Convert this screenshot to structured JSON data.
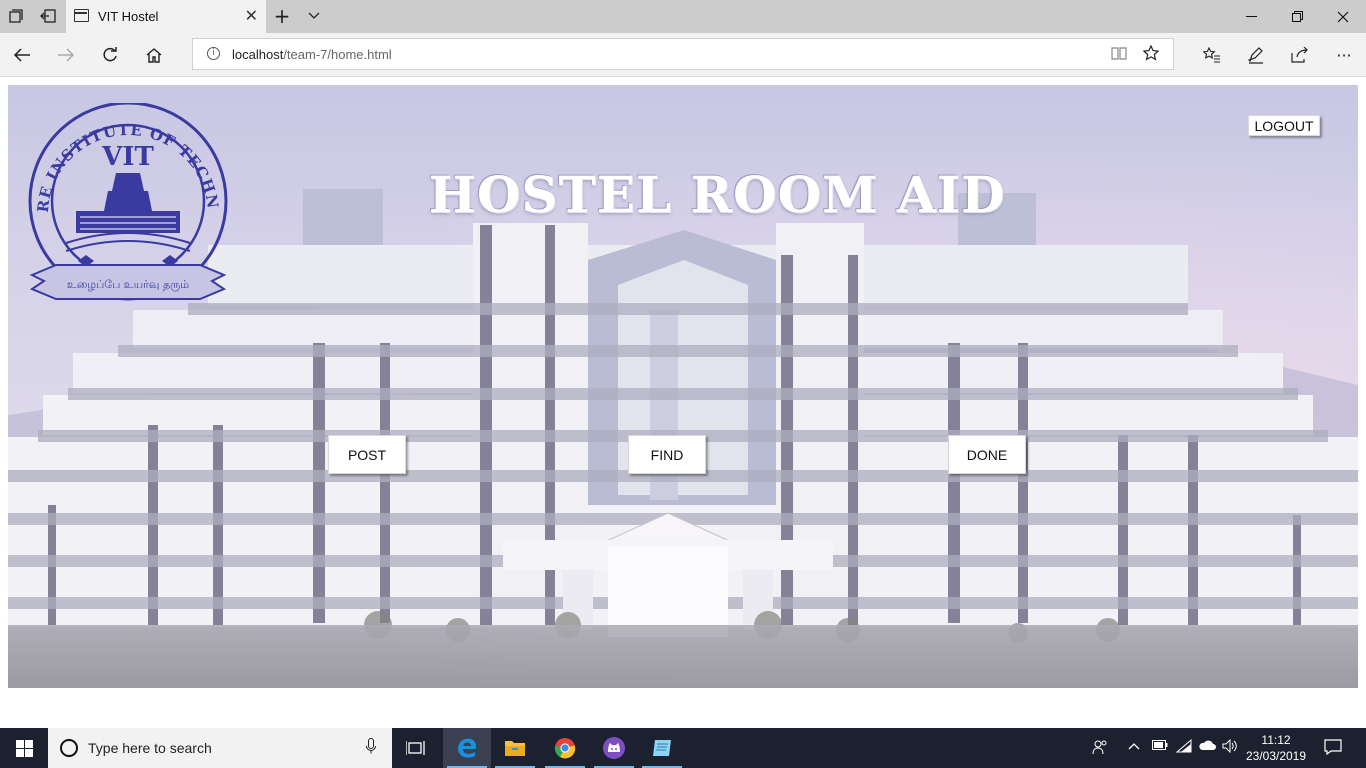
{
  "browser": {
    "tab_title": "VIT Hostel",
    "address_host": "localhost",
    "address_path": "/team-7/home.html"
  },
  "page": {
    "title": "HOSTEL ROOM AID",
    "logout_label": "LOGOUT",
    "buttons": {
      "post": "POST",
      "find": "FIND",
      "done": "DONE"
    },
    "logo": {
      "arc_text": "VELLORE INSTITUTE OF TECHNOLOGY",
      "center_text": "VIT",
      "ribbon_text": "உழைப்பே உயர்வு தரும்",
      "color": "#3a3aa0"
    }
  },
  "taskbar": {
    "search_placeholder": "Type here to search",
    "time": "11:12",
    "date": "23/03/2019"
  },
  "colors": {
    "tabbar": "#cccccc",
    "navbar": "#f2f2f2",
    "taskbar": "#1c2130",
    "title_text": "#ffffff"
  }
}
